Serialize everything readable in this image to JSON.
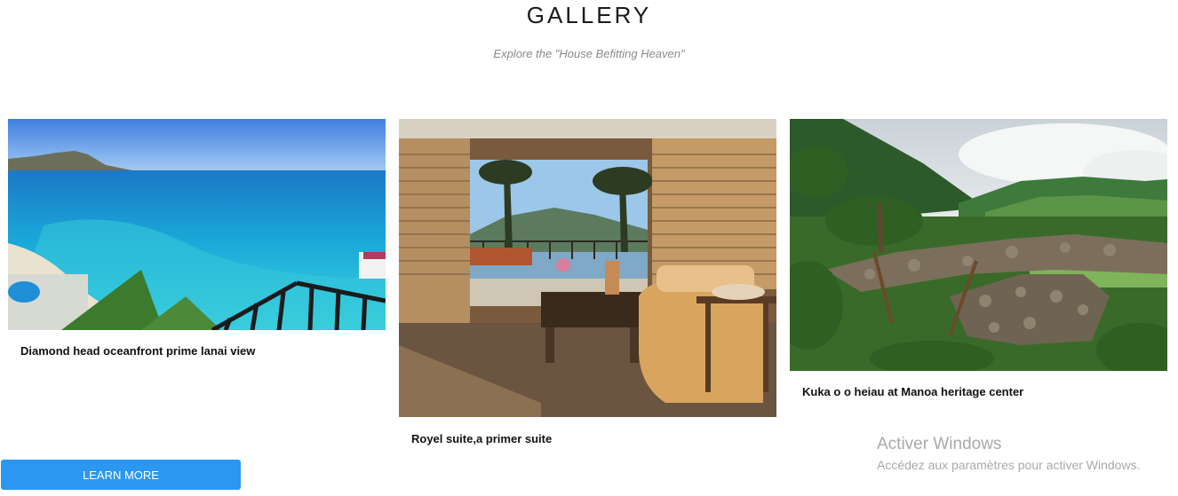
{
  "header": {
    "title": "GALLERY",
    "subtitle": "Explore the \"House Befitting Heaven\""
  },
  "gallery": {
    "items": [
      {
        "caption": "Diamond head oceanfront prime lanai view"
      },
      {
        "caption": "Royel suite,a primer suite"
      },
      {
        "caption": "Kuka o o heiau at Manoa heritage center"
      }
    ]
  },
  "cta": {
    "label": "LEARN MORE",
    "color": "#2b97f0"
  },
  "watermark": {
    "title": "Activer Windows",
    "subtitle": "Accédez aux paramètres pour activer Windows."
  }
}
